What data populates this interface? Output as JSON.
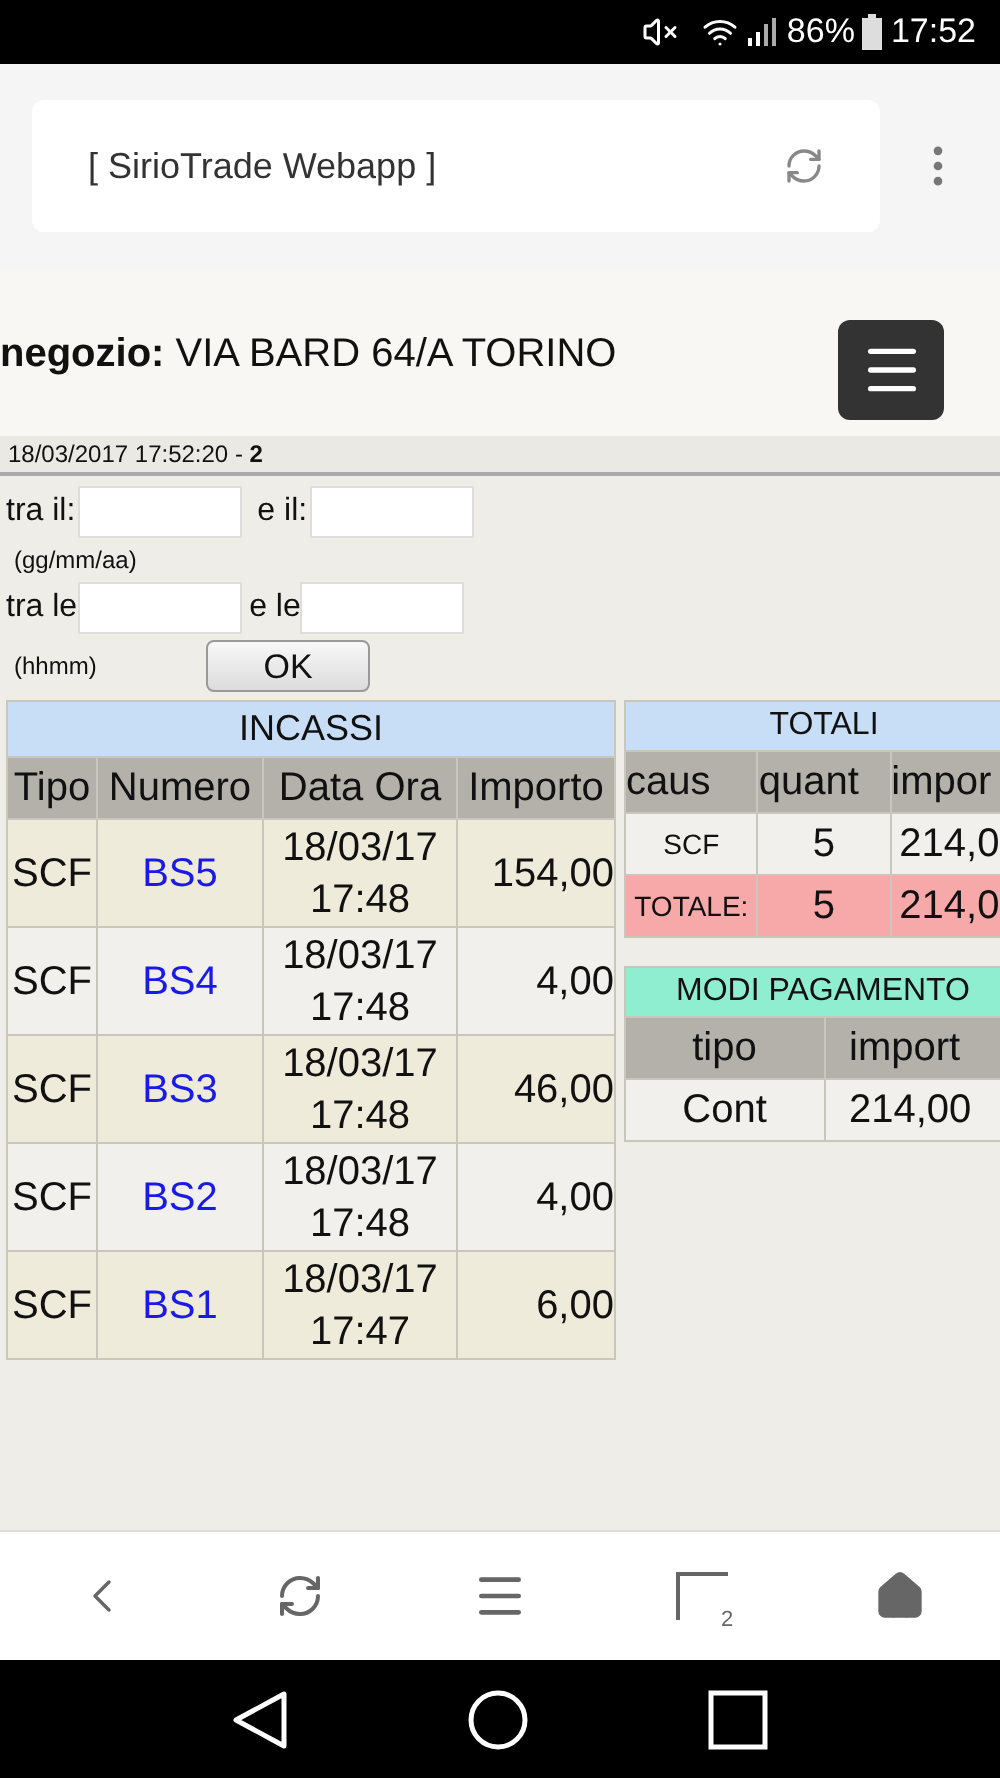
{
  "status_bar": {
    "battery": "86%",
    "time": "17:52"
  },
  "browser": {
    "title": "[ SirioTrade Webapp ]",
    "tab_count": "2"
  },
  "header": {
    "label": "negozio:",
    "value": "VIA BARD 64/A TORINO"
  },
  "timestamp": "18/03/2017 17:52:20 - **2**",
  "filter": {
    "date_from": "tra il:",
    "date_to": "e il:",
    "date_hint": "(gg/mm/aa)",
    "time_from": "tra le",
    "time_to": "e le",
    "time_hint": "(hhmm)",
    "ok": "OK"
  },
  "incassi": {
    "title": "INCASSI",
    "columns": [
      "Tipo",
      "Numero",
      "Data Ora",
      "Importo"
    ],
    "rows": [
      {
        "tipo": "SCF",
        "numero": "BS5",
        "date": "18/03/17",
        "time": "17:48",
        "importo": "154,00"
      },
      {
        "tipo": "SCF",
        "numero": "BS4",
        "date": "18/03/17",
        "time": "17:48",
        "importo": "4,00"
      },
      {
        "tipo": "SCF",
        "numero": "BS3",
        "date": "18/03/17",
        "time": "17:48",
        "importo": "46,00"
      },
      {
        "tipo": "SCF",
        "numero": "BS2",
        "date": "18/03/17",
        "time": "17:48",
        "importo": "4,00"
      },
      {
        "tipo": "SCF",
        "numero": "BS1",
        "date": "18/03/17",
        "time": "17:47",
        "importo": "6,00"
      }
    ]
  },
  "totali": {
    "title": "TOTALI",
    "columns": [
      "caus",
      "quant",
      "impor"
    ],
    "rows": [
      {
        "kind": "item",
        "caus": "SCF",
        "quant": "5",
        "importo": "214,0"
      },
      {
        "kind": "total",
        "caus": "TOTALE:",
        "quant": "5",
        "importo": "214,0"
      }
    ]
  },
  "pagamento": {
    "title": "MODI PAGAMENTO",
    "columns": [
      "tipo",
      "import"
    ],
    "rows": [
      {
        "tipo": "Cont",
        "importo": "214,00"
      }
    ]
  }
}
